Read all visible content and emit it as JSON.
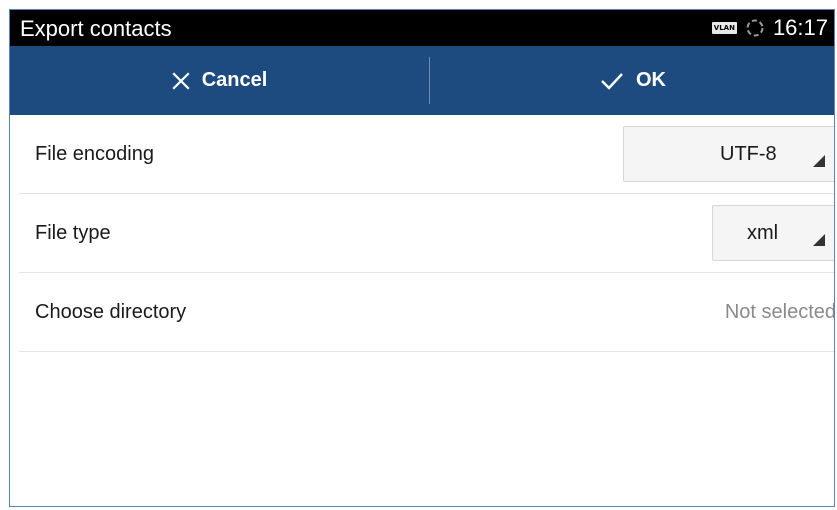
{
  "statusbar": {
    "title": "Export contacts",
    "vlan_badge": "VLAN",
    "time": "16:17"
  },
  "actionbar": {
    "cancel_label": "Cancel",
    "ok_label": "OK"
  },
  "settings": {
    "file_encoding": {
      "label": "File encoding",
      "value": "UTF-8"
    },
    "file_type": {
      "label": "File type",
      "value": "xml"
    },
    "directory": {
      "label": "Choose directory",
      "value": "Not selected"
    }
  },
  "colors": {
    "actionbar_bg": "#1d4a7f",
    "statusbar_bg": "#000000",
    "frame_border": "#5a83b5"
  }
}
